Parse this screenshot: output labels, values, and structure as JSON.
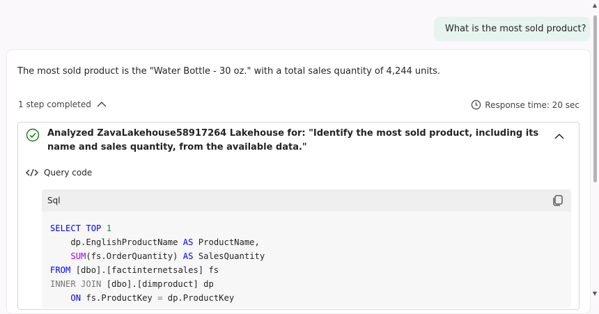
{
  "user_message": "What is the most sold product?",
  "answer": "The most sold product is the \"Water Bottle - 30 oz.\" with a total sales quantity of 4,244 units.",
  "steps": {
    "label": "1 step completed",
    "response_time": "Response time: 20 sec"
  },
  "step": {
    "title": "Analyzed ZavaLakehouse58917264 Lakehouse for: \"Identify the most sold product, including its name and sales quantity, from the available data.\"",
    "query_label": "Query code"
  },
  "code": {
    "language": "Sql",
    "lines": [
      [
        {
          "t": "SELECT TOP ",
          "c": "kw"
        },
        {
          "t": "1",
          "c": "num"
        }
      ],
      [
        {
          "t": "    dp.EnglishProductName ",
          "c": ""
        },
        {
          "t": "AS",
          "c": "kw"
        },
        {
          "t": " ProductName,",
          "c": ""
        }
      ],
      [
        {
          "t": "    ",
          "c": ""
        },
        {
          "t": "SUM",
          "c": "fn"
        },
        {
          "t": "(fs.OrderQuantity) ",
          "c": ""
        },
        {
          "t": "AS",
          "c": "kw"
        },
        {
          "t": " SalesQuantity",
          "c": ""
        }
      ],
      [
        {
          "t": "FROM",
          "c": "kw"
        },
        {
          "t": " [dbo].[factinternetsales] fs",
          "c": ""
        }
      ],
      [
        {
          "t": "INNER JOIN",
          "c": "gray"
        },
        {
          "t": " [dbo].[dimproduct] dp",
          "c": ""
        }
      ],
      [
        {
          "t": "    ",
          "c": ""
        },
        {
          "t": "ON",
          "c": "kw"
        },
        {
          "t": " fs.ProductKey ",
          "c": ""
        },
        {
          "t": "=",
          "c": "gray"
        },
        {
          "t": " dp.ProductKey",
          "c": ""
        }
      ]
    ]
  },
  "icons": {
    "check": "check-circle-icon",
    "chevron_up": "chevron-up-icon",
    "clock": "clock-icon",
    "code": "code-icon",
    "copy": "copy-icon"
  }
}
